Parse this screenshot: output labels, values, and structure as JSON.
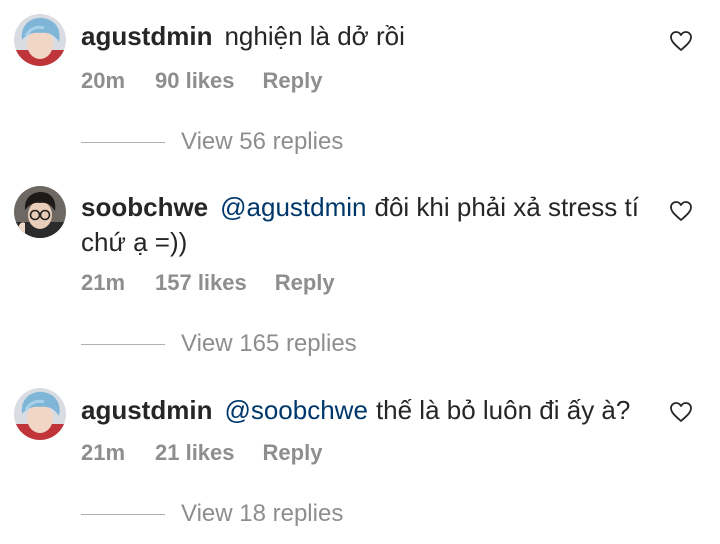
{
  "comments": [
    {
      "username": "agustdmin",
      "mention": "",
      "text": "nghiện là dở rồi",
      "time": "20m",
      "likes": "90 likes",
      "reply_label": "Reply",
      "view_replies": "View 56 replies",
      "avatar": "avatar-blue-hair-icon"
    },
    {
      "username": "soobchwe",
      "mention": "@agustdmin",
      "text": "đôi khi phải xả stress tí chứ ạ =))",
      "time": "21m",
      "likes": "157 likes",
      "reply_label": "Reply",
      "view_replies": "View 165 replies",
      "avatar": "avatar-glasses-icon"
    },
    {
      "username": "agustdmin",
      "mention": "@soobchwe",
      "text": "thế là bỏ luôn đi ấy à?",
      "time": "21m",
      "likes": "21 likes",
      "reply_label": "Reply",
      "view_replies": "View 18 replies",
      "avatar": "avatar-blue-hair-icon"
    }
  ],
  "colors": {
    "text": "#262626",
    "secondary": "#8e8e8e",
    "mention": "#00376b"
  }
}
